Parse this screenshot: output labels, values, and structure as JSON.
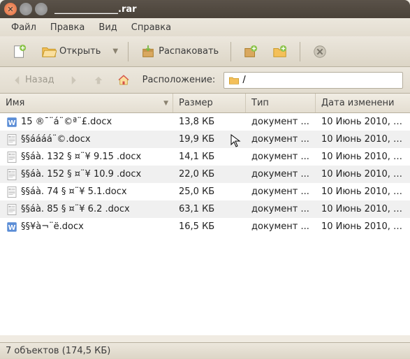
{
  "window": {
    "title": "______________.rar"
  },
  "menu": {
    "file": "Файл",
    "edit": "Правка",
    "view": "Вид",
    "help": "Справка"
  },
  "toolbar": {
    "open": "Открыть",
    "extract": "Распаковать"
  },
  "nav": {
    "back": "Назад",
    "location_label": "Расположение:",
    "path": "/"
  },
  "columns": {
    "name": "Имя",
    "size": "Размер",
    "type": "Тип",
    "date": "Дата изменени"
  },
  "files": [
    {
      "icon": "word",
      "name": "15 ®¯¨á¨©ª¨£.docx",
      "size": "13,8 КБ",
      "type": "документ ...",
      "date": "10 Июнь 2010, 2..."
    },
    {
      "icon": "generic",
      "name": "§§áááá¨©.docx",
      "size": "19,9 КБ",
      "type": "документ ...",
      "date": "10 Июнь 2010, 2..."
    },
    {
      "icon": "generic",
      "name": "§§áà. 132 § ¤¨¥ 9.15 .docx",
      "size": "14,1 КБ",
      "type": "документ ...",
      "date": "10 Июнь 2010, 2..."
    },
    {
      "icon": "generic",
      "name": "§§áà. 152 § ¤¨¥ 10.9 .docx",
      "size": "22,0 КБ",
      "type": "документ ...",
      "date": "10 Июнь 2010, 2..."
    },
    {
      "icon": "generic",
      "name": "§§áà. 74 § ¤¨¥ 5.1.docx",
      "size": "25,0 КБ",
      "type": "документ ...",
      "date": "10 Июнь 2010, 2..."
    },
    {
      "icon": "generic",
      "name": "§§áà. 85 § ¤¨¥ 6.2 .docx",
      "size": "63,1 КБ",
      "type": "документ ...",
      "date": "10 Июнь 2010, 2..."
    },
    {
      "icon": "word",
      "name": "§§¥à¬¨ë.docx",
      "size": "16,5 КБ",
      "type": "документ ...",
      "date": "10 Июнь 2010, 2..."
    }
  ],
  "status": "7 объектов (174,5 КБ)"
}
